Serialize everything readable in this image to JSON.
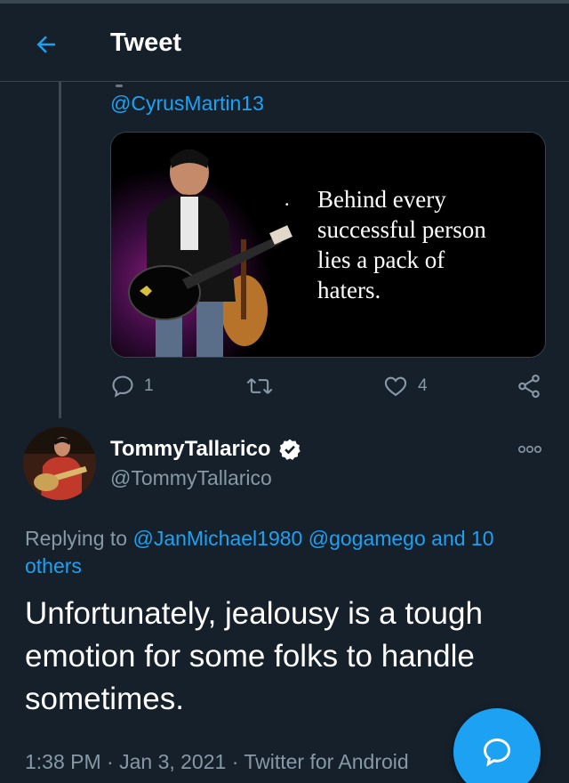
{
  "header": {
    "title": "Tweet",
    "back_icon": "arrow-left-icon"
  },
  "colors": {
    "background": "#15202b",
    "accent": "#1da1f2",
    "secondary_text": "#8899a6",
    "divider": "#38444d"
  },
  "parent_tweet": {
    "handle": "@CyrusMartin13",
    "media": {
      "quote_lines": [
        "Behind every",
        "successful person",
        "lies a pack of",
        "haters."
      ]
    },
    "actions": {
      "reply_count": "1",
      "retweet_count": "",
      "like_count": "4",
      "icons": [
        "reply-icon",
        "retweet-icon",
        "like-icon",
        "share-icon"
      ]
    }
  },
  "main_tweet": {
    "display_name": "TommyTallarico",
    "username": "@TommyTallarico",
    "verified": true,
    "replying_prefix": "Replying to ",
    "replying_mentions": [
      "@JanMichael1980",
      "@gogamego",
      "and 10 others"
    ],
    "text": "Unfortunately, jealousy is a tough emotion for some folks to handle sometimes.",
    "timestamp": "1:38 PM · Jan 3, 2021",
    "separator": " · ",
    "source": "Twitter for Android"
  },
  "fab": {
    "icon": "compose-reply-icon"
  }
}
